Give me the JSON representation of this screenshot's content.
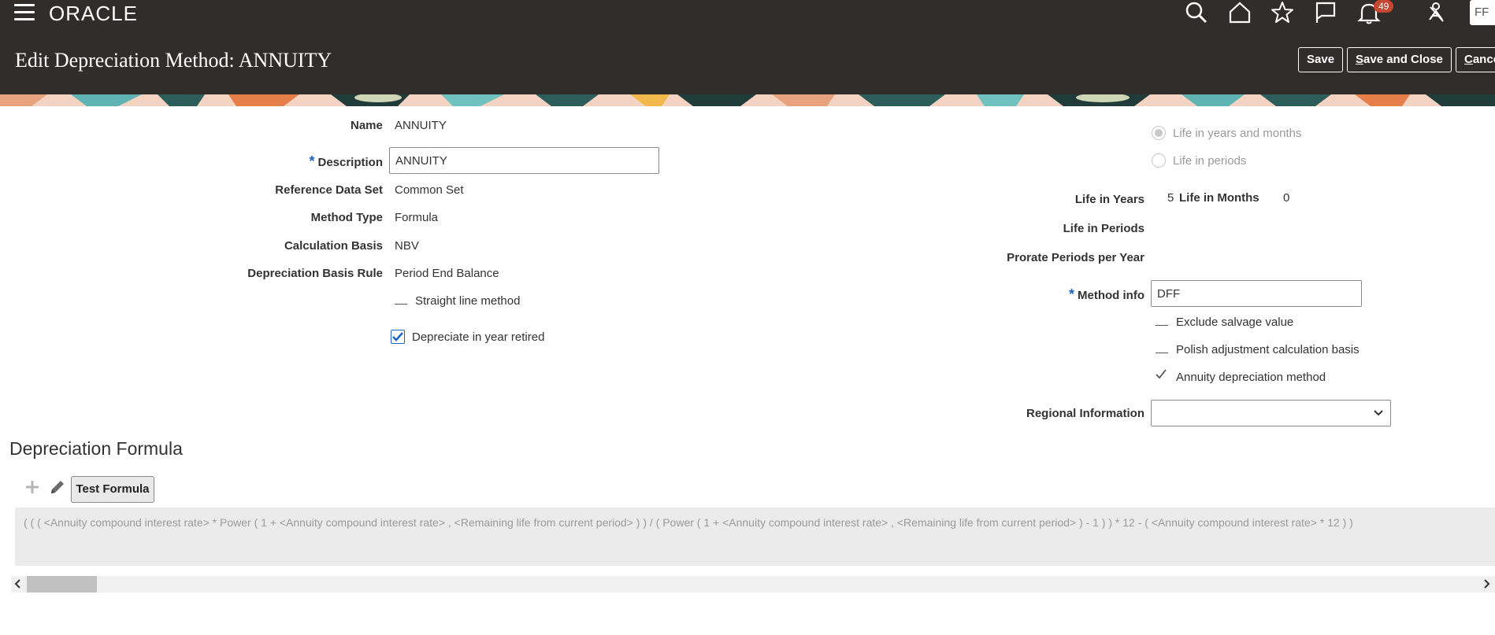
{
  "header": {
    "logo": "ORACLE",
    "notification_count": "49",
    "avatar_initials": "FF",
    "page_title": "Edit Depreciation Method: ANNUITY",
    "save_label": "Save",
    "save_close_label": "Save and Close",
    "cancel_label": "Cancel"
  },
  "form": {
    "name_label": "Name",
    "name_value": "ANNUITY",
    "description_label": "Description",
    "description_value": "ANNUITY",
    "reference_label": "Reference Data Set",
    "reference_value": "Common Set",
    "method_type_label": "Method Type",
    "method_type_value": "Formula",
    "calc_basis_label": "Calculation Basis",
    "calc_basis_value": "NBV",
    "dep_basis_label": "Depreciation Basis Rule",
    "dep_basis_value": "Period End Balance",
    "straight_line_label": "Straight line method",
    "depreciate_retired_label": "Depreciate in year retired",
    "life_years_months_label": "Life in years and months",
    "life_periods_radio_label": "Life in periods",
    "life_in_years_label": "Life in Years",
    "life_in_years_value": "5",
    "life_in_months_label": "Life in Months",
    "life_in_months_value": "0",
    "life_in_periods_label": "Life in Periods",
    "prorate_label": "Prorate Periods per Year",
    "method_info_label": "Method info",
    "method_info_value": "DFF",
    "exclude_salvage_label": "Exclude salvage value",
    "polish_label": "Polish adjustment calculation basis",
    "annuity_label": "Annuity depreciation method",
    "regional_label": "Regional Information",
    "regional_value": ""
  },
  "formula_section": {
    "title": "Depreciation Formula",
    "test_button": "Test Formula",
    "formula_text": "( ( ( <Annuity compound interest rate>  * Power  ( 1 + <Annuity compound interest rate>  , <Remaining life from current period>  ) ) / ( Power  ( 1 + <Annuity compound interest rate>  , <Remaining life from current period>  ) - 1 ) ) * 12 - ( <Annuity compound interest rate>  * 12 ) )"
  },
  "colors": {
    "header_bg": "#312d2a",
    "accent_blue": "#1b64c4",
    "badge_red": "#c74634"
  }
}
